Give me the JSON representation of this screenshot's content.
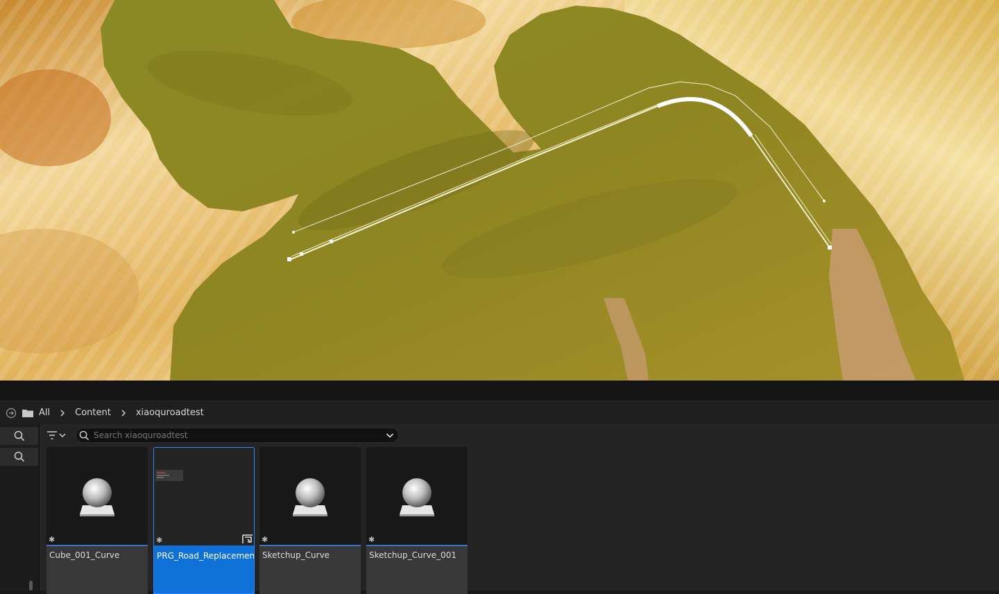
{
  "breadcrumb": {
    "items": [
      "All",
      "Content",
      "xiaoquroadtest"
    ]
  },
  "search": {
    "placeholder": "Search xiaoquroadtest"
  },
  "assets": [
    {
      "name": "Cube_001_Curve",
      "type": "static-mesh",
      "selected": false
    },
    {
      "name": "PRG_Road_Replacement",
      "type": "blueprint",
      "selected": true
    },
    {
      "name": "Sketchup_Curve",
      "type": "static-mesh",
      "selected": false
    },
    {
      "name": "Sketchup_Curve_001",
      "type": "static-mesh",
      "selected": false
    }
  ],
  "colors": {
    "selection": "#0f70d7",
    "asset_bar": "#3a72c4",
    "terrain_grass": "#8a8422",
    "terrain_sand": "#e8c879"
  },
  "icons": [
    "history-icon",
    "folder-icon",
    "chevron-right-icon",
    "search-icon",
    "filter-icon",
    "chevron-down-icon",
    "star-icon",
    "sphere-icon",
    "blueprint-icon"
  ]
}
